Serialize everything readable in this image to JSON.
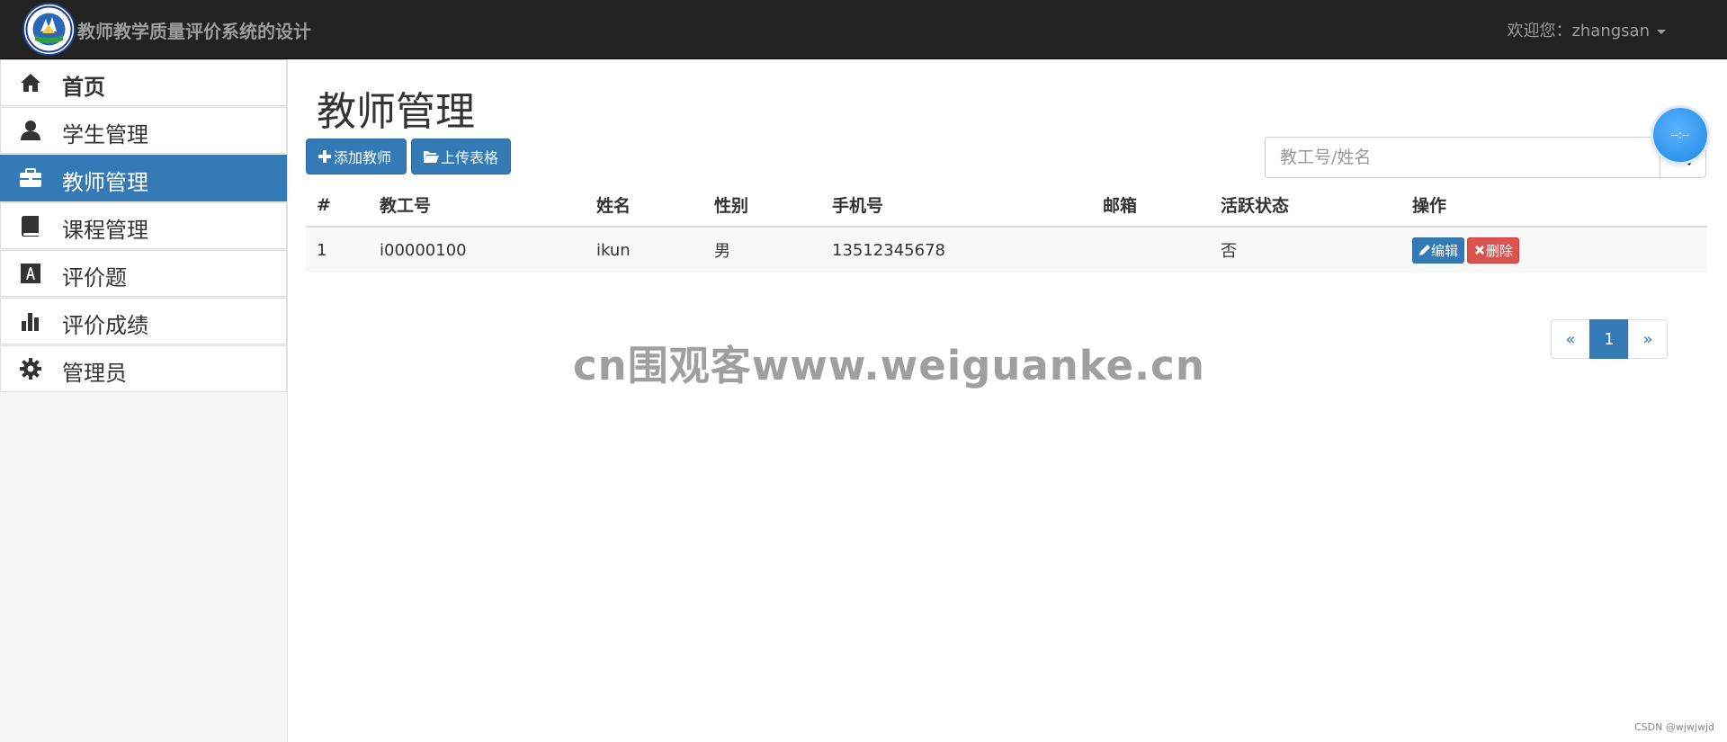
{
  "navbar": {
    "brand": "教师教学质量评价系统的设计",
    "welcome_prefix": "欢迎您：",
    "username": "zhangsan"
  },
  "sidebar": {
    "items": [
      {
        "label": "首页",
        "icon": "home-icon",
        "active": false
      },
      {
        "label": "学生管理",
        "icon": "user-icon",
        "active": false
      },
      {
        "label": "教师管理",
        "icon": "briefcase-icon",
        "active": true
      },
      {
        "label": "课程管理",
        "icon": "book-icon",
        "active": false
      },
      {
        "label": "评价题",
        "icon": "font-icon",
        "active": false
      },
      {
        "label": "评价成绩",
        "icon": "stats-icon",
        "active": false
      },
      {
        "label": "管理员",
        "icon": "cog-icon",
        "active": false
      }
    ]
  },
  "main": {
    "title": "教师管理",
    "add_button": "添加教师",
    "upload_button": "上传表格",
    "search_placeholder": "教工号/姓名",
    "table": {
      "headers": [
        "#",
        "教工号",
        "姓名",
        "性别",
        "手机号",
        "邮箱",
        "活跃状态",
        "操作"
      ],
      "rows": [
        {
          "index": "1",
          "id": "i00000100",
          "name": "ikun",
          "gender": "男",
          "phone": "13512345678",
          "email": "",
          "active": "否"
        }
      ],
      "edit_label": "编辑",
      "delete_label": "删除"
    },
    "pagination": {
      "prev": "«",
      "current": "1",
      "next": "»"
    }
  },
  "float_button": "--:--",
  "watermark": "cn围观客www.weiguanke.cn",
  "credit": "CSDN @wjwjwjd",
  "colors": {
    "primary": "#337ab7",
    "danger": "#d9534f",
    "navbar": "#222222"
  }
}
